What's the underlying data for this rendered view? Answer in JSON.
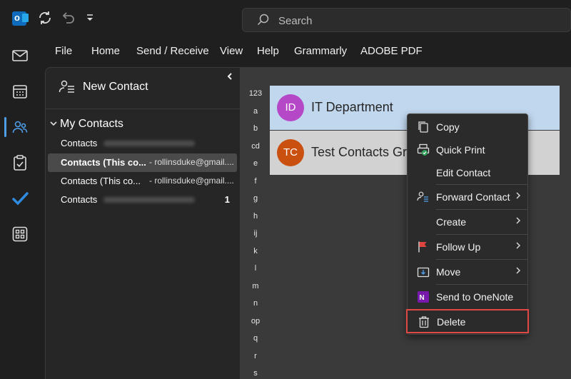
{
  "titlebar": {
    "search_placeholder": "Search"
  },
  "menubar": [
    "File",
    "Home",
    "Send / Receive",
    "View",
    "Help",
    "Grammarly",
    "ADOBE PDF"
  ],
  "folder_pane": {
    "new_contact_label": "New Contact",
    "group_label": "My Contacts",
    "folders": [
      {
        "name": "Contacts",
        "address": "",
        "count": ""
      },
      {
        "name": "Contacts (This co...",
        "address": "- rollinsduke@gmail....",
        "count": ""
      },
      {
        "name": "Contacts (This co...",
        "address": "- rollinsduke@gmail....",
        "count": ""
      },
      {
        "name": "Contacts",
        "address": "",
        "count": "1"
      }
    ]
  },
  "index_letters": [
    "123",
    "a",
    "b",
    "cd",
    "e",
    "f",
    "g",
    "h",
    "ij",
    "k",
    "l",
    "m",
    "n",
    "op",
    "q",
    "r",
    "s"
  ],
  "contacts": [
    {
      "initials": "ID",
      "name": "IT Department",
      "color": "#b548c6"
    },
    {
      "initials": "TC",
      "name": "Test Contacts Gro",
      "color": "#ca5010"
    }
  ],
  "context_menu": {
    "copy": "Copy",
    "quick_print": "Quick Print",
    "edit_contact": "Edit Contact",
    "forward_contact": "Forward Contact",
    "create": "Create",
    "follow_up": "Follow Up",
    "move": "Move",
    "send_to_onenote": "Send to OneNote",
    "delete": "Delete"
  },
  "colors": {
    "accent": "#4f9ee8",
    "selected_row": "#c1d7ee",
    "delete_highlight": "#e04848"
  }
}
